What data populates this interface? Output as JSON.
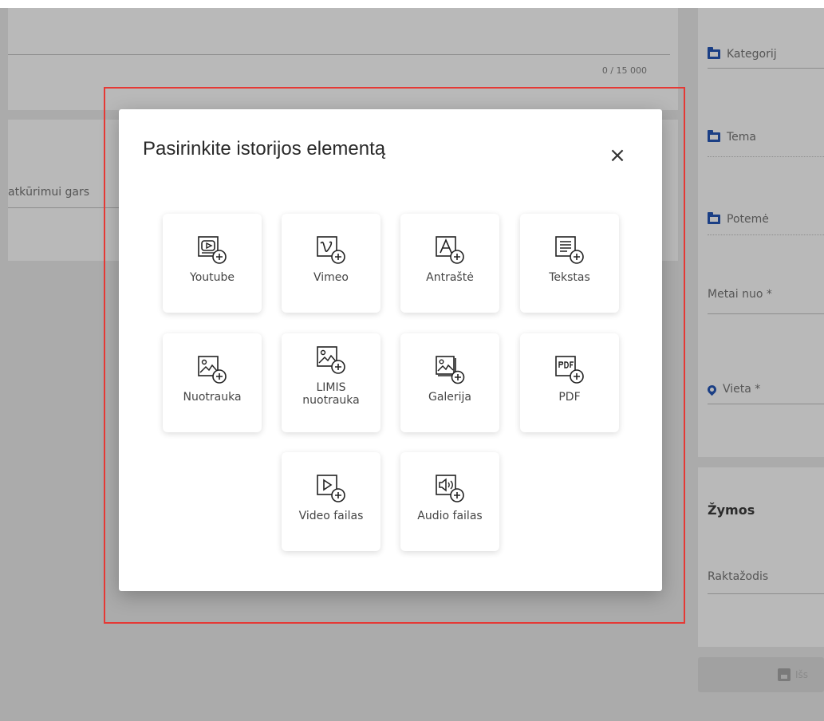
{
  "background": {
    "char_counter": "0 / 15 000",
    "left_field_text": "atkūrimui gars",
    "right_panel": {
      "kategorija": "Kategorij",
      "tema": "Tema",
      "potema": "Potemė",
      "metai": "Metai nuo *",
      "vieta": "Vieta *",
      "zymos_title": "Žymos",
      "raktazodis": "Raktažodis",
      "save_label": "Išs"
    }
  },
  "modal": {
    "title": "Pasirinkite istorijos elementą",
    "close": "×",
    "tiles": [
      {
        "label": "Youtube",
        "icon": "youtube-add-icon"
      },
      {
        "label": "Vimeo",
        "icon": "vimeo-add-icon"
      },
      {
        "label": "Antraštė",
        "icon": "heading-add-icon"
      },
      {
        "label": "Tekstas",
        "icon": "text-add-icon"
      },
      {
        "label": "Nuotrauka",
        "icon": "image-add-icon"
      },
      {
        "label": "LIMIS nuotrauka",
        "icon": "limis-image-add-icon"
      },
      {
        "label": "Galerija",
        "icon": "gallery-add-icon"
      },
      {
        "label": "PDF",
        "icon": "pdf-add-icon"
      },
      {
        "label": "Video failas",
        "icon": "video-file-add-icon"
      },
      {
        "label": "Audio failas",
        "icon": "audio-file-add-icon"
      }
    ]
  },
  "colors": {
    "overlay": "#ababab",
    "highlight": "#e53935",
    "accent": "#1b3f85"
  }
}
